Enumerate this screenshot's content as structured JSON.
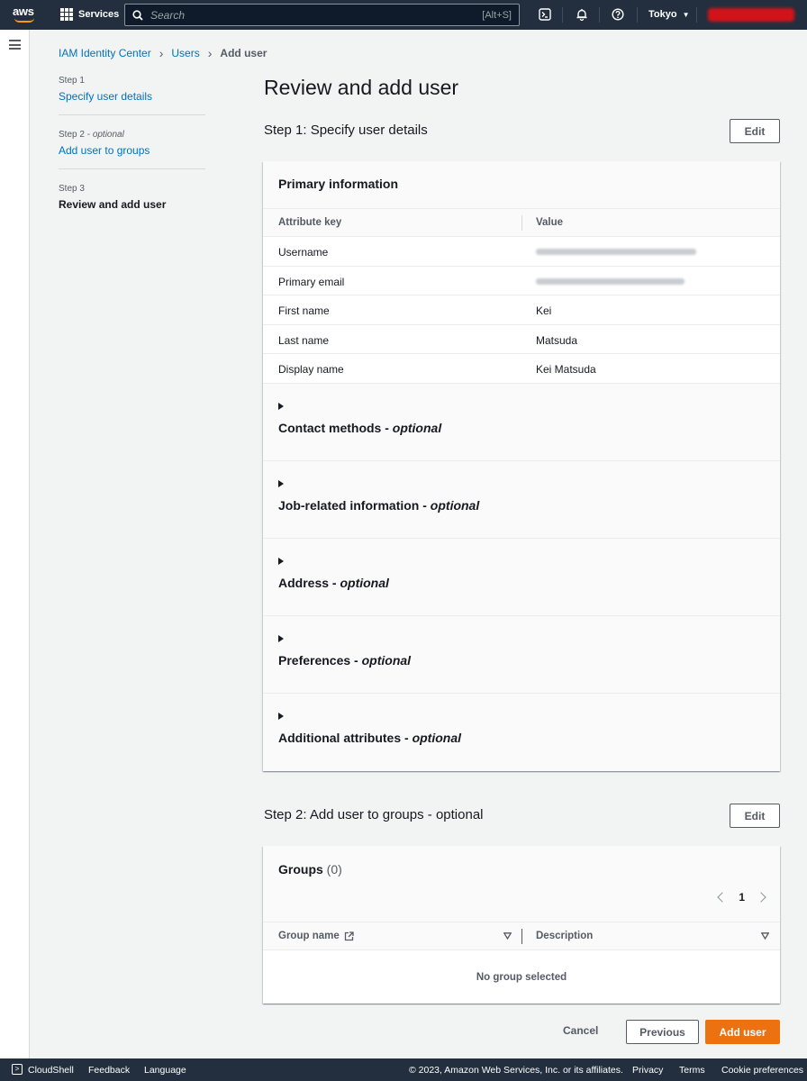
{
  "topnav": {
    "logo": "aws",
    "services_label": "Services",
    "search_placeholder": "Search",
    "search_shortcut": "[Alt+S]",
    "region": "Tokyo"
  },
  "breadcrumb": {
    "items": [
      "IAM Identity Center",
      "Users"
    ],
    "current": "Add user"
  },
  "steps": [
    {
      "label": "Step 1",
      "title": "Specify user details"
    },
    {
      "label": "Step 2",
      "optional": "optional",
      "title": "Add user to groups"
    },
    {
      "label": "Step 3",
      "title": "Review and add user"
    }
  ],
  "page_title": "Review and add user",
  "section1": {
    "title": "Step 1: Specify user details",
    "edit_label": "Edit",
    "panel_title": "Primary information",
    "col_key": "Attribute key",
    "col_value": "Value",
    "rows": [
      {
        "key": "Username",
        "value": ""
      },
      {
        "key": "Primary email",
        "value": ""
      },
      {
        "key": "First name",
        "value": "Kei"
      },
      {
        "key": "Last name",
        "value": "Matsuda"
      },
      {
        "key": "Display name",
        "value": "Kei Matsuda"
      }
    ],
    "expanders": [
      {
        "title": "Contact methods - ",
        "optional": "optional"
      },
      {
        "title": "Job-related information - ",
        "optional": "optional"
      },
      {
        "title": "Address - ",
        "optional": "optional"
      },
      {
        "title": "Preferences - ",
        "optional": "optional"
      },
      {
        "title": "Additional attributes - ",
        "optional": "optional"
      }
    ]
  },
  "section2": {
    "title": "Step 2: Add user to groups - optional",
    "edit_label": "Edit",
    "groups_title": "Groups",
    "groups_count": "(0)",
    "page": "1",
    "col_group": "Group name",
    "col_description": "Description",
    "empty": "No group selected"
  },
  "actions": {
    "cancel": "Cancel",
    "previous": "Previous",
    "add_user": "Add user"
  },
  "footer": {
    "cloudshell": "CloudShell",
    "feedback": "Feedback",
    "language": "Language",
    "copyright": "© 2023, Amazon Web Services, Inc. or its affiliates.",
    "privacy": "Privacy",
    "terms": "Terms",
    "cookie": "Cookie preferences"
  },
  "colors": {
    "nav_bg": "#232f3e",
    "link": "#0073bb",
    "primary": "#ec7211"
  }
}
